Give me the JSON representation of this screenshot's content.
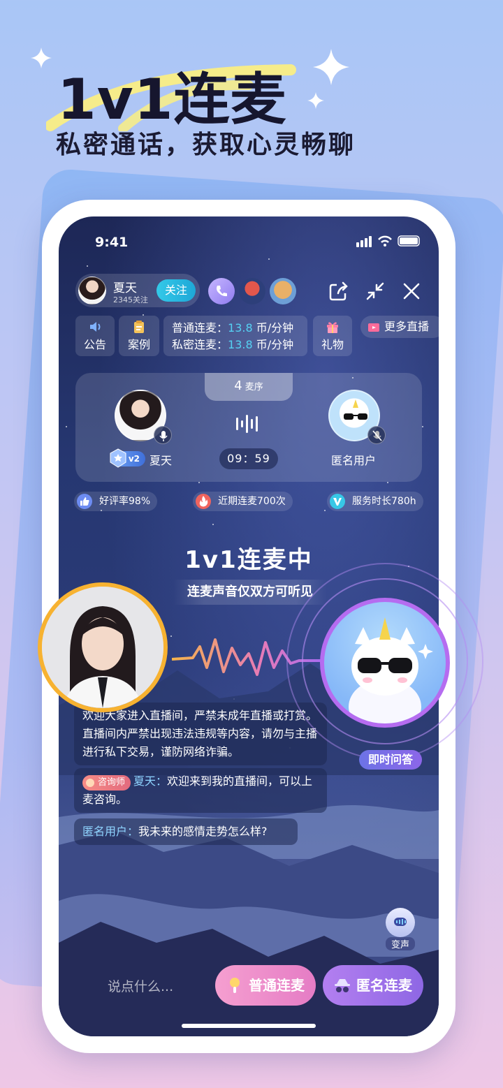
{
  "promo": {
    "title": "1v1连麦",
    "subtitle": "私密通话，获取心灵畅聊"
  },
  "status_bar": {
    "time": "9:41"
  },
  "header": {
    "host_name": "夏天",
    "host_follows": "2345关注",
    "follow_label": "关注",
    "viewer_icons": [
      "phone-icon",
      "viewer-avatar",
      "viewer-avatar"
    ],
    "actions": [
      "share-icon",
      "minimize-icon",
      "close-icon"
    ]
  },
  "info_bar": {
    "notice_label": "公告",
    "cases_label": "案例",
    "price_normal_label": "普通连麦：",
    "price_normal_value": "13.8",
    "price_private_label": "私密连麦：",
    "price_private_value": "13.8",
    "price_unit": "币/分钟",
    "gift_label": "礼物",
    "more_live_label": "更多直播"
  },
  "mic_panel": {
    "queue_count": "4",
    "queue_label": "麦序",
    "host_level": "v2",
    "host_name": "夏天",
    "timer": "09：59",
    "guest_name": "匿名用户"
  },
  "stats": [
    {
      "label": "好评率98%",
      "icon": "thumbs-up-icon",
      "color": "#6d8cf2"
    },
    {
      "label": "近期连麦700次",
      "icon": "fire-icon",
      "color": "#f0645e"
    },
    {
      "label": "服务时长780h",
      "icon": "v-icon",
      "color": "#37c7e6"
    }
  ],
  "live": {
    "title": "1v1连麦中",
    "subtitle": "连麦声音仅双方可听见",
    "qa_label": "即时问答"
  },
  "chat": {
    "system_notice": "欢迎大家进入直播间，严禁未成年直播或打赏。直播间内严禁出现违法违规等内容，请勿与主播进行私下交易，谨防网络诈骗。",
    "host_role": "咨询师",
    "host_author": "夏天：",
    "host_message": "欢迎来到我的直播间，可以上麦咨询。",
    "guest_author": "匿名用户：",
    "guest_message": "我未来的感情走势怎么样?"
  },
  "bottom": {
    "voice_changer_label": "变声",
    "input_placeholder": "说点什么...",
    "normal_mic_label": "普通连麦",
    "anon_mic_label": "匿名连麦"
  }
}
